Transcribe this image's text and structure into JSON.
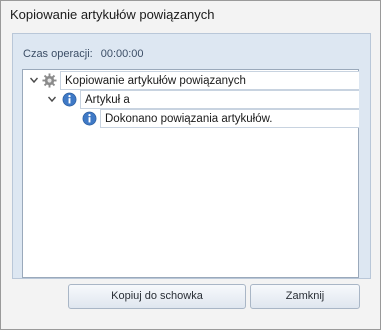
{
  "window": {
    "title": "Kopiowanie artykułów powiązanych"
  },
  "operation": {
    "label": "Czas operacji:",
    "value": "00:00:00"
  },
  "tree": {
    "nodes": [
      {
        "label": "Kopiowanie artykułów powiązanych",
        "icon": "gear-icon",
        "expanded": true
      },
      {
        "label": "Artykuł a",
        "icon": "info-icon",
        "expanded": true
      },
      {
        "label": "Dokonano powiązania artykułów.",
        "icon": "info-icon"
      }
    ]
  },
  "buttons": {
    "copy_label": "Kopiuj do schowka",
    "close_label": "Zamknij"
  }
}
